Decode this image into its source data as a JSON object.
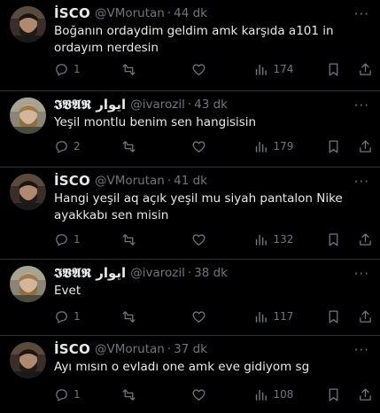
{
  "tweets": [
    {
      "name": "İSCO",
      "handle": "@VMorutan",
      "sep": "·",
      "time": "44 dk",
      "text": "Boğanın ordaydim geldim amk karşıda a101 in ordayım nerdesin",
      "replies": "1",
      "views": "174",
      "avatar": "man-dark-beard"
    },
    {
      "name": "𝕴𝖁𝕬𝕽 ايوار",
      "handle": "@ivarozil",
      "sep": "·",
      "time": "43 dk",
      "text": "Yeşil montlu benim sen hangisisin",
      "replies": "2",
      "views": "179",
      "avatar": "man-blond-beard"
    },
    {
      "name": "İSCO",
      "handle": "@VMorutan",
      "sep": "·",
      "time": "41 dk",
      "text": "Hangi yeşil aq açık yeşil mu siyah pantalon Nike ayakkabı sen misin",
      "replies": "1",
      "views": "132",
      "avatar": "man-dark-beard"
    },
    {
      "name": "𝕴𝖁𝕬𝕽 ايوار",
      "handle": "@ivarozil",
      "sep": "·",
      "time": "38 dk",
      "text": "Evet",
      "replies": "1",
      "views": "117",
      "avatar": "man-blond-beard"
    },
    {
      "name": "İSCO",
      "handle": "@VMorutan",
      "sep": "·",
      "time": "37 dk",
      "text": "Ayı mısın o evladı one amk eve gidiyom sg",
      "replies": "1",
      "views": "108",
      "avatar": "man-dark-beard"
    }
  ],
  "more_glyph": "···",
  "colors": {
    "background": "#000000",
    "text": "#e7e9ea",
    "muted": "#71767b",
    "divider": "#2f3336"
  },
  "icons": [
    "reply-icon",
    "retweet-icon",
    "like-icon",
    "views-icon",
    "bookmark-icon",
    "share-icon",
    "more-icon"
  ]
}
